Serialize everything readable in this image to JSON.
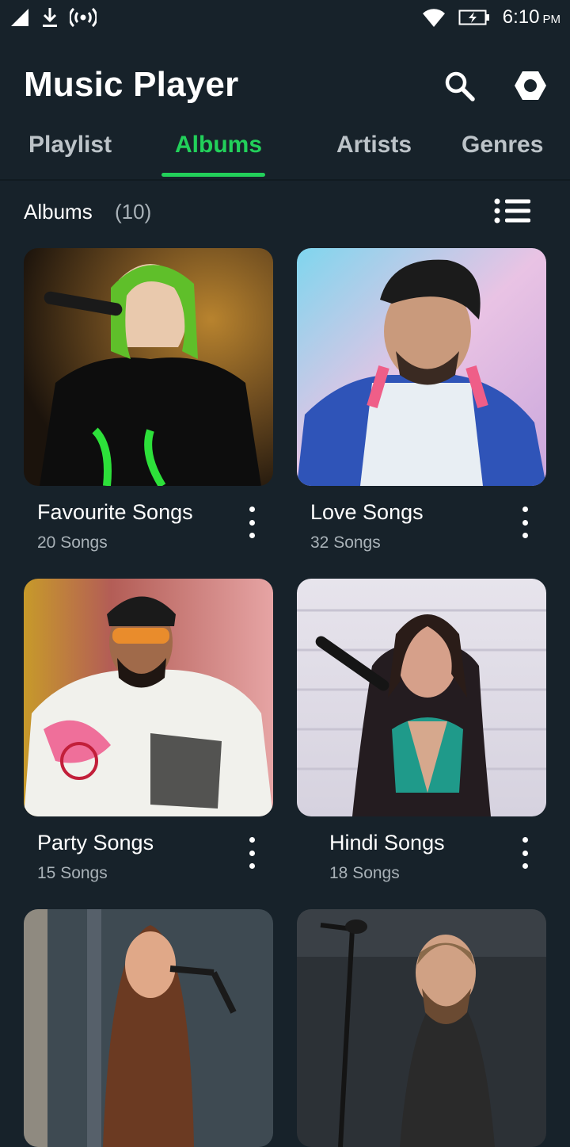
{
  "status_bar": {
    "time": "6:10",
    "ampm": "PM",
    "icons": [
      "signal-icon",
      "download-icon",
      "hotspot-icon",
      "wifi-icon",
      "battery-charging-icon"
    ]
  },
  "header": {
    "title": "Music Player",
    "icons": [
      "search-icon",
      "settings-icon"
    ]
  },
  "tabs": [
    {
      "label": "Playlist",
      "active": false
    },
    {
      "label": "Albums",
      "active": true
    },
    {
      "label": "Artists",
      "active": false
    },
    {
      "label": "Genres",
      "active": false
    }
  ],
  "section": {
    "title": "Albums",
    "count": "(10)",
    "view_icon": "list-view-icon"
  },
  "albums": [
    {
      "name": "Favourite Songs",
      "count": "20 Songs"
    },
    {
      "name": "Love Songs",
      "count": "32 Songs"
    },
    {
      "name": "Party Songs",
      "count": "15 Songs"
    },
    {
      "name": "Hindi Songs",
      "count": "18 Songs"
    },
    {
      "name": "",
      "count": ""
    },
    {
      "name": "",
      "count": ""
    }
  ],
  "colors": {
    "background": "#17222a",
    "accent": "#22d05a",
    "text_secondary": "#a9b2b8"
  }
}
